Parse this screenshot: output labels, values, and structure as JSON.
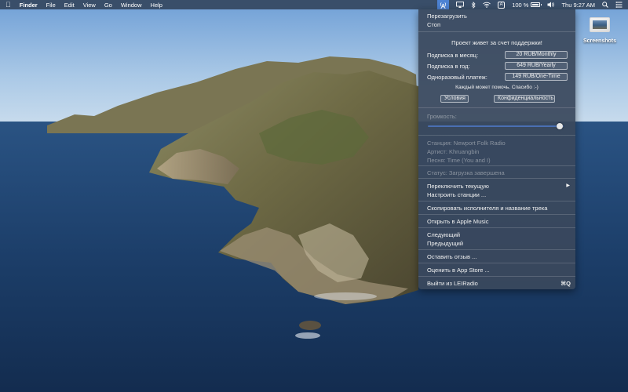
{
  "menubar": {
    "apple_icon": "apple-logo-icon",
    "app_name": "Finder",
    "menus": [
      "File",
      "Edit",
      "View",
      "Go",
      "Window",
      "Help"
    ],
    "input_source": "A",
    "battery_percent": "100 %",
    "battery_level": 1.0,
    "clock": "Thu 9:27 AM"
  },
  "desktop": {
    "icon_label": "Screenshots"
  },
  "menu": {
    "restart": "Перезагрузить",
    "stop": "Стоп",
    "support_title": "Проект живет за счет поддержки!",
    "subscriptions": [
      {
        "label": "Подписка в месяц:",
        "price": "20 RUB/Monthly"
      },
      {
        "label": "Подписка в год:",
        "price": "649 RUB/Yearly"
      },
      {
        "label": "Одноразовый платеж:",
        "price": "149 RUB/One-Time"
      }
    ],
    "thanks": "Каждый может помочь. Спасибо :-)",
    "terms": "Условия",
    "privacy": "Конфиденциальность",
    "volume_label": "Громкость:",
    "volume_level": 0.97,
    "station": "Станция: Newport Folk Radio",
    "artist": "Артист: Khruangbin",
    "song": "Песня: Time (You and I)",
    "status": "Статус: Загрузка завершена",
    "switch_current": "Переключить текущую",
    "configure_stations": "Настроить станции ...",
    "copy_artist_title": "Скопировать исполнителя и название трека",
    "open_apple_music": "Открыть в Apple Music",
    "next": "Следующий",
    "previous": "Предыдущий",
    "leave_review": "Оставить отзыв ...",
    "rate_app_store": "Оценить в App Store ...",
    "quit": "Выйти из LEIRadio",
    "quit_shortcut": "⌘Q"
  }
}
